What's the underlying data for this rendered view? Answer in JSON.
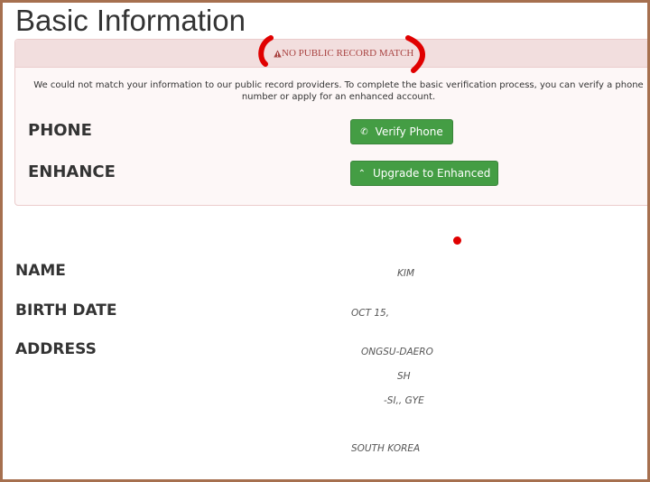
{
  "page_title": "Basic Information",
  "alert": {
    "title": "NO PUBLIC RECORD MATCH",
    "message": "We could not match your information to our public record providers. To complete the basic verification process, you can verify a phone number or apply for an enhanced account.",
    "phone_label": "PHONE",
    "phone_button": "Verify Phone",
    "enhance_label": "ENHANCE",
    "enhance_button": "Upgrade to Enhanced"
  },
  "info": {
    "name_label": "NAME",
    "name_value": "KIM",
    "birth_label": "BIRTH DATE",
    "birth_value": "OCT 15,",
    "address_label": "ADDRESS",
    "address_lines": [
      "ONGSU-DAERO",
      "SH",
      "-SI,, GYE",
      "",
      "SOUTH KOREA"
    ]
  },
  "colors": {
    "alert_text": "#a94442",
    "button_green": "#449d44",
    "frame_border": "#a6704f",
    "annotation_red": "#e00000"
  }
}
